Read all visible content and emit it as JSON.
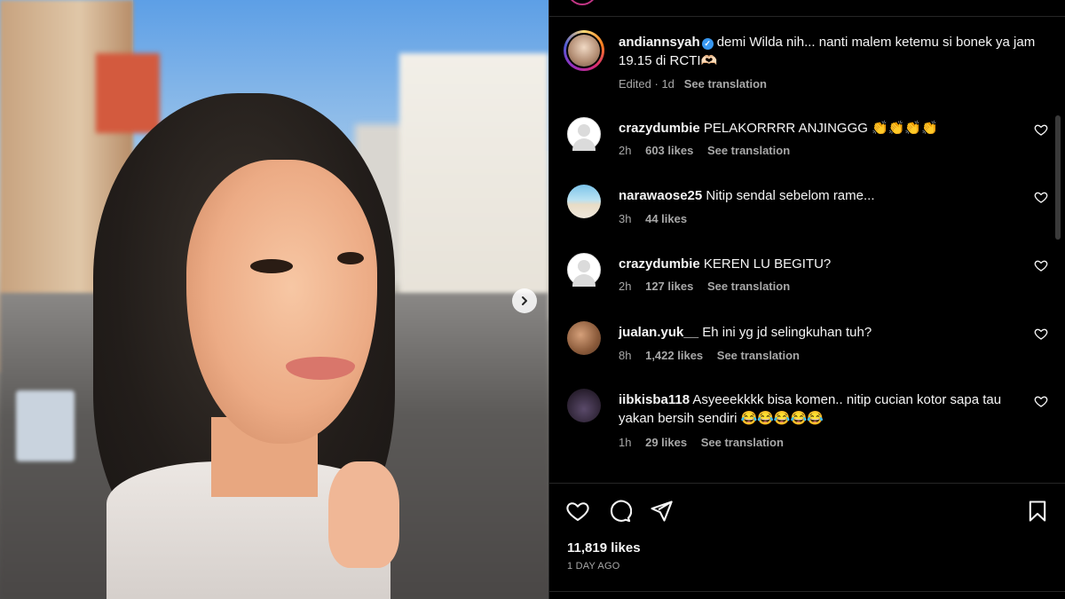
{
  "post": {
    "nav_next_icon": "chevron-right-icon"
  },
  "caption": {
    "username": "andiannsyah",
    "text": "demi Wilda nih... nanti malem ketemu si bonek ya jam 19.15 di RCTI🫶🏻",
    "edited": "Edited",
    "age": "1d",
    "translate": "See translation"
  },
  "comments": [
    {
      "username": "crazydumbie",
      "text": "PELAKORRRR ANJINGGG 👏👏👏👏",
      "age": "2h",
      "likes": "603 likes",
      "translate": "See translation",
      "avatar": "blank"
    },
    {
      "username": "narawaose25",
      "text": "Nitip sendal sebelom rame...",
      "age": "3h",
      "likes": "44 likes",
      "translate": "",
      "avatar": "beach"
    },
    {
      "username": "crazydumbie",
      "text": "KEREN LU BEGITU?",
      "age": "2h",
      "likes": "127 likes",
      "translate": "See translation",
      "avatar": "blank"
    },
    {
      "username": "jualan.yuk__",
      "text": "Eh ini yg jd selingkuhan tuh?",
      "age": "8h",
      "likes": "1,422 likes",
      "translate": "See translation",
      "avatar": "food"
    },
    {
      "username": "iibkisba118",
      "text": "Asyeeekkkk bisa komen.. nitip cucian kotor sapa tau yakan bersih sendiri 😂😂😂😂😂",
      "age": "1h",
      "likes": "29 likes",
      "translate": "See translation",
      "avatar": "dark"
    }
  ],
  "actions": {
    "like_icon": "heart-icon",
    "comment_icon": "comment-icon",
    "share_icon": "share-icon",
    "save_icon": "bookmark-icon"
  },
  "footer": {
    "likes": "11,819 likes",
    "time_ago": "1 DAY AGO"
  }
}
